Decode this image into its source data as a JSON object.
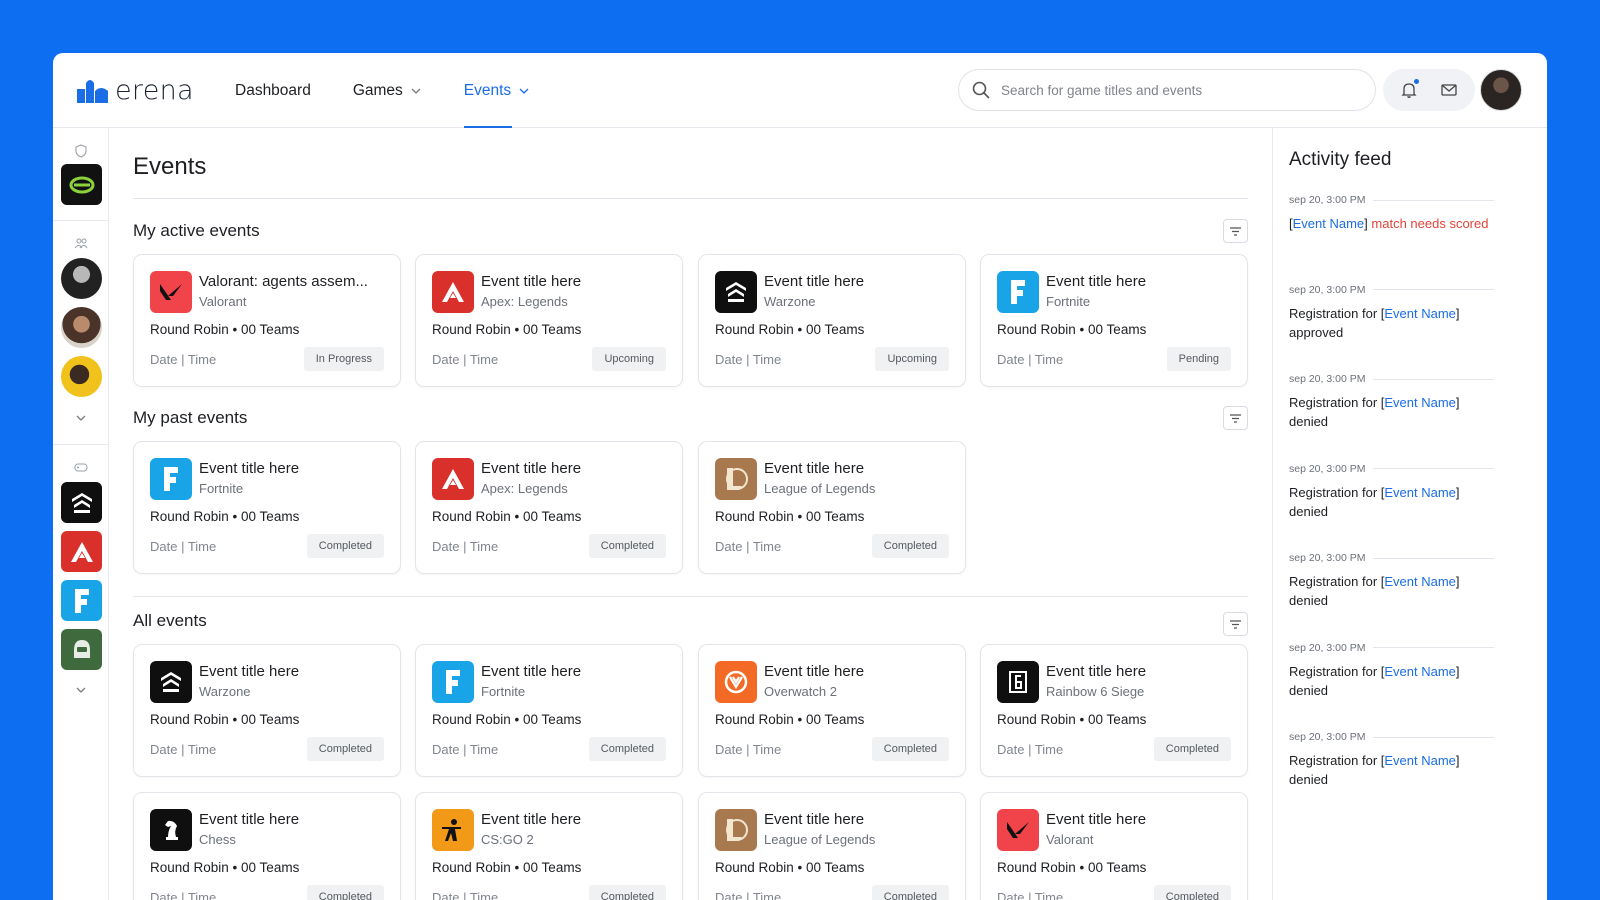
{
  "app": {
    "logo_text": "erena"
  },
  "nav": {
    "items": [
      {
        "label": "Dashboard",
        "has_dropdown": false,
        "active": false
      },
      {
        "label": "Games",
        "has_dropdown": true,
        "active": false
      },
      {
        "label": "Events",
        "has_dropdown": true,
        "active": true
      }
    ]
  },
  "search": {
    "placeholder": "Search for game titles and events",
    "value": ""
  },
  "header_icons": [
    "bell-icon",
    "mail-icon"
  ],
  "page": {
    "title": "Events"
  },
  "sections": {
    "active": {
      "title": "My active events"
    },
    "past": {
      "title": "My past events"
    },
    "all": {
      "title": "All events"
    }
  },
  "active_events": [
    {
      "title": "Valorant: agents assem...",
      "game": "Valorant",
      "format": "Round Robin • 00 Teams",
      "date": "Date | Time",
      "status": "In Progress",
      "icon": "valorant"
    },
    {
      "title": "Event title here",
      "game": "Apex: Legends",
      "format": "Round Robin • 00 Teams",
      "date": "Date | Time",
      "status": "Upcoming",
      "icon": "apex"
    },
    {
      "title": "Event title here",
      "game": "Warzone",
      "format": "Round Robin • 00 Teams",
      "date": "Date | Time",
      "status": "Upcoming",
      "icon": "warzone"
    },
    {
      "title": "Event title here",
      "game": "Fortnite",
      "format": "Round Robin • 00 Teams",
      "date": "Date | Time",
      "status": "Pending",
      "icon": "fortnite"
    }
  ],
  "past_events": [
    {
      "title": "Event title here",
      "game": "Fortnite",
      "format": "Round Robin • 00 Teams",
      "date": "Date | Time",
      "status": "Completed",
      "icon": "fortnite"
    },
    {
      "title": "Event title here",
      "game": "Apex: Legends",
      "format": "Round Robin • 00 Teams",
      "date": "Date | Time",
      "status": "Completed",
      "icon": "apex"
    },
    {
      "title": "Event title here",
      "game": "League of Legends",
      "format": "Round Robin • 00 Teams",
      "date": "Date | Time",
      "status": "Completed",
      "icon": "lol"
    }
  ],
  "all_events": [
    {
      "title": "Event title here",
      "game": "Warzone",
      "format": "Round Robin • 00 Teams",
      "date": "Date | Time",
      "status": "Completed",
      "icon": "warzone"
    },
    {
      "title": "Event title here",
      "game": "Fortnite",
      "format": "Round Robin • 00 Teams",
      "date": "Date | Time",
      "status": "Completed",
      "icon": "fortnite"
    },
    {
      "title": "Event title here",
      "game": "Overwatch 2",
      "format": "Round Robin • 00 Teams",
      "date": "Date | Time",
      "status": "Completed",
      "icon": "overwatch"
    },
    {
      "title": "Event title here",
      "game": "Rainbow 6 Siege",
      "format": "Round Robin • 00 Teams",
      "date": "Date | Time",
      "status": "Completed",
      "icon": "r6"
    },
    {
      "title": "Event title here",
      "game": "Chess",
      "format": "Round Robin • 00 Teams",
      "date": "Date | Time",
      "status": "Completed",
      "icon": "chess"
    },
    {
      "title": "Event title here",
      "game": "CS:GO 2",
      "format": "Round Robin • 00 Teams",
      "date": "Date | Time",
      "status": "Completed",
      "icon": "csgo"
    },
    {
      "title": "Event title here",
      "game": "League of Legends",
      "format": "Round Robin • 00 Teams",
      "date": "Date | Time",
      "status": "Completed",
      "icon": "lol"
    },
    {
      "title": "Event title here",
      "game": "Valorant",
      "format": "Round Robin • 00 Teams",
      "date": "Date | Time",
      "status": "Completed",
      "icon": "valorant"
    }
  ],
  "activity": {
    "title": "Activity feed",
    "items": [
      {
        "time": "sep 20, 3:00 PM",
        "pre": "[",
        "link": "Event Name",
        "mid": "]",
        "post": " match needs scored",
        "post_warn": true
      },
      {
        "time": "sep 20, 3:00 PM",
        "pre": "Registration for [",
        "link": "Event Name",
        "mid": "]",
        "post": " approved",
        "post_warn": false
      },
      {
        "time": "sep 20, 3:00 PM",
        "pre": "Registration for [",
        "link": "Event Name",
        "mid": "]",
        "post": " denied",
        "post_warn": false
      },
      {
        "time": "sep 20, 3:00 PM",
        "pre": "Registration for [",
        "link": "Event Name",
        "mid": "]",
        "post": " denied",
        "post_warn": false
      },
      {
        "time": "sep 20, 3:00 PM",
        "pre": "Registration for [",
        "link": "Event Name",
        "mid": "]",
        "post": " denied",
        "post_warn": false
      },
      {
        "time": "sep 20, 3:00 PM",
        "pre": "Registration for [",
        "link": "Event Name",
        "mid": "]",
        "post": " denied",
        "post_warn": false
      },
      {
        "time": "sep 20, 3:00 PM",
        "pre": "Registration for [",
        "link": "Event Name",
        "mid": "]",
        "post": " denied",
        "post_warn": false
      }
    ]
  },
  "rail": {
    "sections": [
      "shield-icon",
      "people-icon",
      "gamepad-icon"
    ],
    "teams": [
      "optic"
    ],
    "friends": [
      "friend-1",
      "friend-2",
      "friend-3"
    ],
    "games": [
      "warzone",
      "apex",
      "fortnite",
      "halo"
    ]
  },
  "colors": {
    "accent": "#1b6de5",
    "background": "#0d6ef2",
    "warn": "#e0443a"
  }
}
